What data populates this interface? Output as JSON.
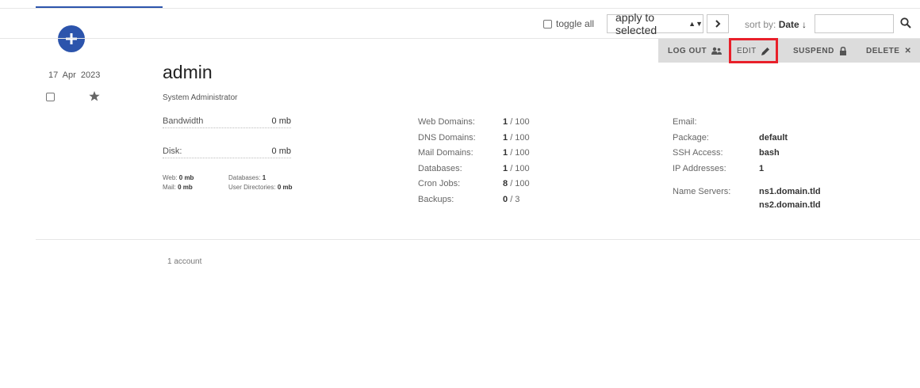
{
  "toolbar": {
    "toggle_all": "toggle all",
    "apply_label": "apply to selected",
    "apply_arrows": "⇕",
    "go_label": "›",
    "sort_prefix": "sort by:",
    "sort_field": "Date ↓",
    "search_value": ""
  },
  "actions": {
    "logout": "LOG OUT",
    "edit": "EDIT",
    "suspend": "SUSPEND",
    "delete": "DELETE",
    "delete_glyph": "✕"
  },
  "user": {
    "date": "17 Apr 2023",
    "username": "admin",
    "fullname": "System Administrator",
    "bandwidth_label": "Bandwidth",
    "bandwidth_value": "0 mb",
    "disk_label": "Disk:",
    "disk_value": "0 mb",
    "web_label": "Web:",
    "web_value": "0 mb",
    "mail_label": "Mail:",
    "mail_value": "0 mb",
    "db_label": "Databases:",
    "db_value": "1",
    "userdir_label": "User Directories:",
    "userdir_value": "0 mb"
  },
  "stats": [
    {
      "label": "Web Domains:",
      "used": "1",
      "limit": "/ 100"
    },
    {
      "label": "DNS Domains:",
      "used": "1",
      "limit": "/ 100"
    },
    {
      "label": "Mail Domains:",
      "used": "1",
      "limit": "/ 100"
    },
    {
      "label": "Databases:",
      "used": "1",
      "limit": "/ 100"
    },
    {
      "label": "Cron Jobs:",
      "used": "8",
      "limit": "/ 100"
    },
    {
      "label": "Backups:",
      "used": "0",
      "limit": "/ 3"
    }
  ],
  "info": {
    "email_label": "Email:",
    "email_value": "",
    "package_label": "Package:",
    "package_value": "default",
    "ssh_label": "SSH Access:",
    "ssh_value": "bash",
    "ip_label": "IP Addresses:",
    "ip_value": "1",
    "ns_label": "Name Servers:",
    "ns1": "ns1.domain.tld",
    "ns2": "ns2.domain.tld"
  },
  "footer": {
    "count": "1 account"
  },
  "colors": {
    "accent": "#2c54ac",
    "highlight": "#e8202a",
    "action_bar": "#dcdcdc"
  },
  "icons": {
    "add": "plus-icon",
    "go": "chevron-right-icon",
    "search": "search-icon",
    "logout": "users-icon",
    "edit": "pencil-icon",
    "suspend": "lock-icon",
    "delete": "close-icon",
    "favorite": "star-icon"
  }
}
